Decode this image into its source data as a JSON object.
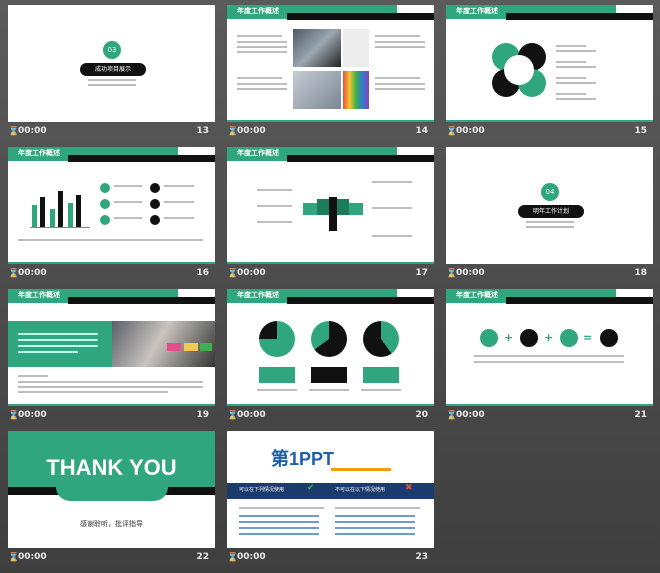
{
  "slides": [
    {
      "num": "13",
      "time": "00:00"
    },
    {
      "num": "14",
      "time": "00:00"
    },
    {
      "num": "15",
      "time": "00:00"
    },
    {
      "num": "16",
      "time": "00:00"
    },
    {
      "num": "17",
      "time": "00:00"
    },
    {
      "num": "18",
      "time": "00:00"
    },
    {
      "num": "19",
      "time": "00:00"
    },
    {
      "num": "20",
      "time": "00:00"
    },
    {
      "num": "21",
      "time": "00:00"
    },
    {
      "num": "22",
      "time": "00:00"
    },
    {
      "num": "23",
      "time": "00:00"
    }
  ],
  "s13": {
    "badge": "03",
    "title": "成功项目展示"
  },
  "header_title": "年度工作概述",
  "s18": {
    "badge": "04",
    "title": "明年工作计划"
  },
  "s22": {
    "thanks": "THANK YOU",
    "subtitle": "感谢聆听，批评指导"
  },
  "s23": {
    "logo_main": "第1PPT",
    "left_head": "可以在下列情况使用",
    "right_head": "不可以在以下情况使用"
  },
  "colors": {
    "accent": "#2fa67e",
    "dark": "#111111",
    "background": "#4a4a4a"
  },
  "icons": {
    "time": "hourglass-icon"
  }
}
